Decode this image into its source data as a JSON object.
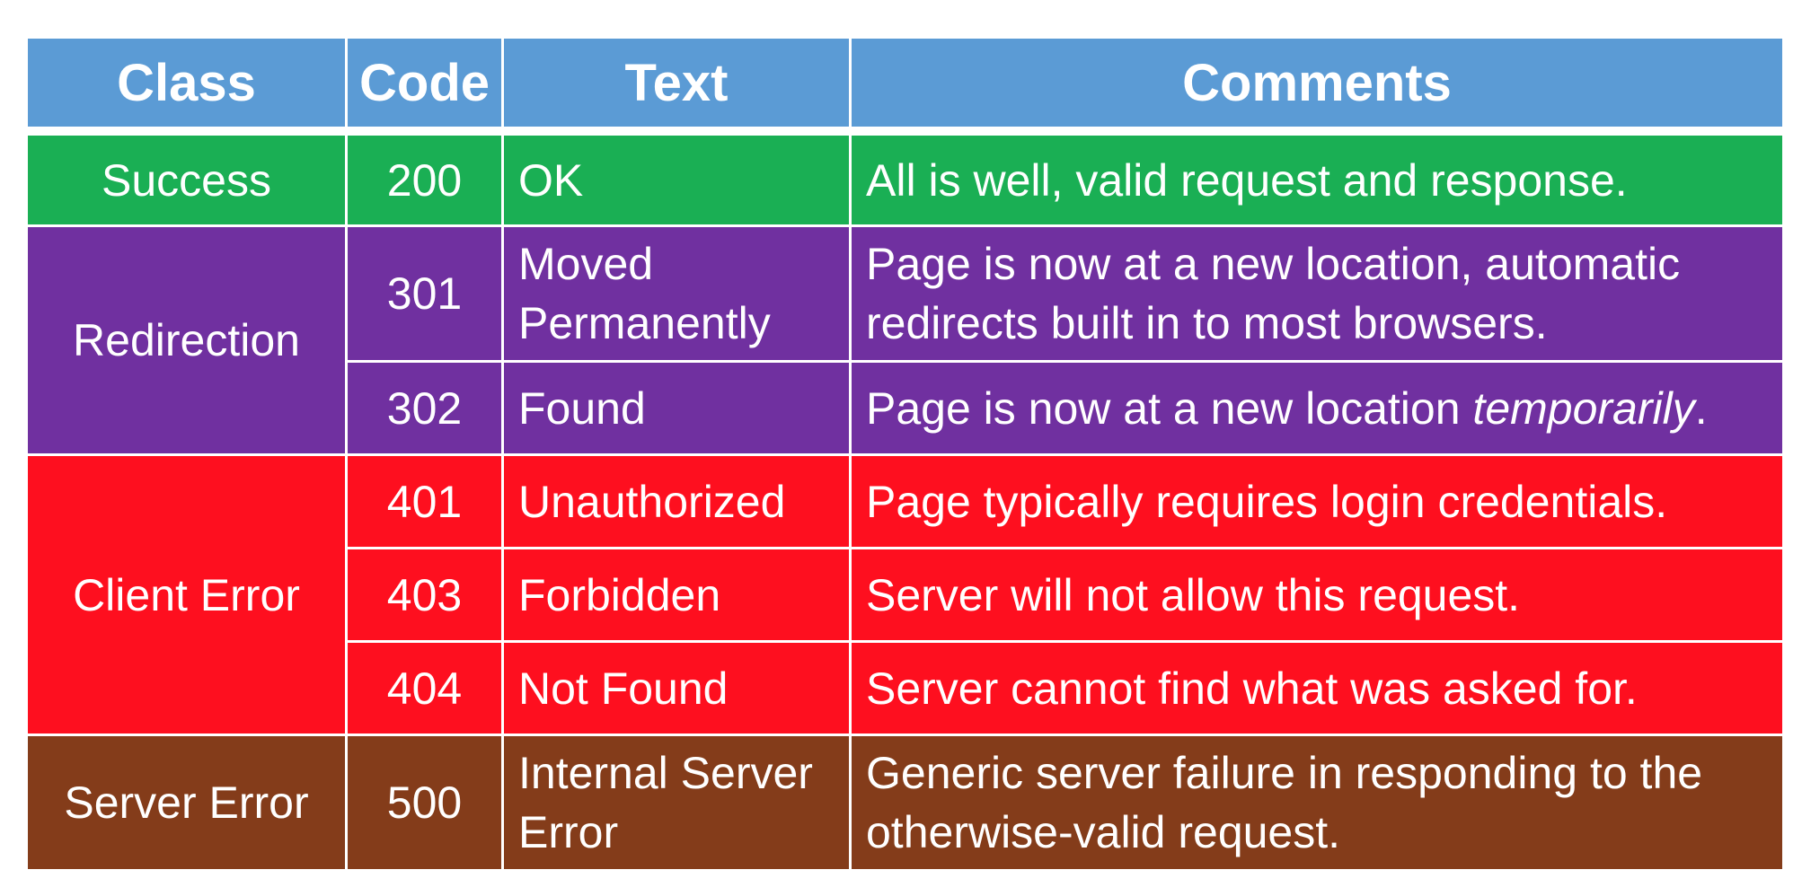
{
  "table": {
    "headers": {
      "class": "Class",
      "code": "Code",
      "text": "Text",
      "comments": "Comments"
    },
    "groups": {
      "success": {
        "label": "Success",
        "color": "#1aaf54",
        "rows": [
          {
            "code": "200",
            "text": "OK",
            "comment": "All is well, valid request and response."
          }
        ]
      },
      "redirection": {
        "label": "Redirection",
        "color": "#7030a0",
        "rows": [
          {
            "code": "301",
            "text_line1": "Moved",
            "text_line2": "Permanently",
            "comment_line1": "Page is now at a new location, automatic",
            "comment_line2": "redirects built in to most browsers."
          },
          {
            "code": "302",
            "text": "Found",
            "comment_prefix": "Page is now at a new location ",
            "comment_emphasis": "temporarily",
            "comment_suffix": "."
          }
        ]
      },
      "client_error": {
        "label": "Client Error",
        "color": "#fe0f1f",
        "rows": [
          {
            "code": "401",
            "text": "Unauthorized",
            "comment": "Page typically requires login credentials."
          },
          {
            "code": "403",
            "text": "Forbidden",
            "comment": "Server will not allow this request."
          },
          {
            "code": "404",
            "text": "Not Found",
            "comment": "Server cannot find what was asked for."
          }
        ]
      },
      "server_error": {
        "label": "Server Error",
        "color": "#843c1a",
        "rows": [
          {
            "code": "500",
            "text_line1": "Internal Server",
            "text_line2": "Error",
            "comment_line1": "Generic server failure in responding to the",
            "comment_line2": "otherwise-valid request."
          }
        ]
      }
    },
    "header_color": "#5b9bd5"
  }
}
